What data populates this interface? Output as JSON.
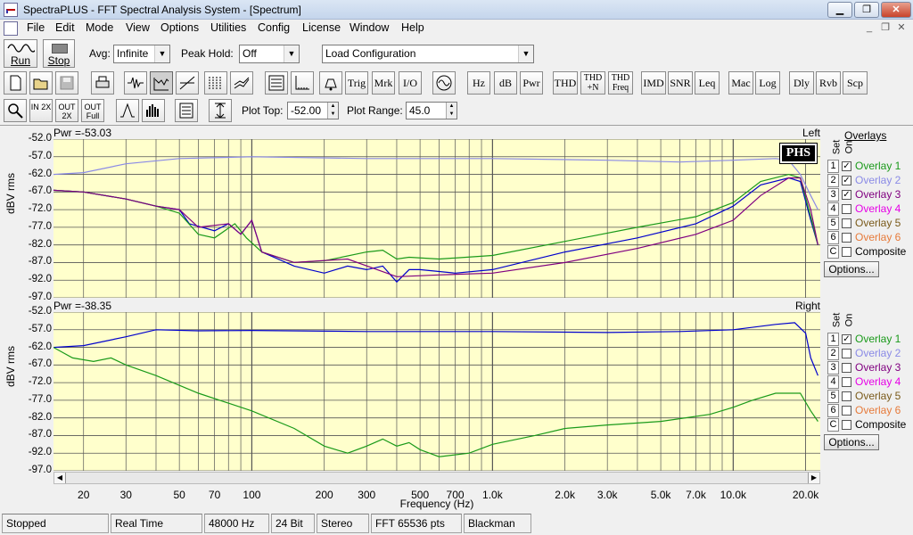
{
  "window": {
    "title": "SpectraPLUS - FFT Spectral Analysis System - [Spectrum]"
  },
  "menu": [
    "File",
    "Edit",
    "Mode",
    "View",
    "Options",
    "Utilities",
    "Config",
    "License",
    "Window",
    "Help"
  ],
  "toolbar1": {
    "run": "Run",
    "stop": "Stop",
    "avg_label": "Avg:",
    "avg_value": "Infinite",
    "peak_label": "Peak Hold:",
    "peak_value": "Off",
    "config_value": "Load Configuration"
  },
  "toolbar2": [
    "Trig",
    "Mrk",
    "I/O",
    "Hz",
    "dB",
    "Pwr",
    "THD",
    "THD +N",
    "THD Freq",
    "IMD",
    "SNR",
    "Leq",
    "Mac",
    "Log",
    "Dly",
    "Rvb",
    "Scp"
  ],
  "toolbar3": {
    "zoom_in_2x": "IN 2X",
    "zoom_out_2x": "OUT 2X",
    "zoom_out_full": "OUT Full",
    "plot_top_label": "Plot Top:",
    "plot_top_value": "-52.00",
    "plot_range_label": "Plot Range:",
    "plot_range_value": "45.0"
  },
  "plots": [
    {
      "channel": "Left",
      "pwr": "Pwr =-53.03",
      "ylabel": "dBV rms",
      "logo": "PHS"
    },
    {
      "channel": "Right",
      "pwr": "Pwr =-38.35",
      "ylabel": "dBV rms"
    }
  ],
  "y_ticks": [
    "-52.0",
    "-57.0",
    "-62.0",
    "-67.0",
    "-72.0",
    "-77.0",
    "-82.0",
    "-87.0",
    "-92.0",
    "-97.0"
  ],
  "x_ticks": [
    "20",
    "30",
    "50",
    "70",
    "100",
    "200",
    "300",
    "500",
    "700",
    "1.0k",
    "2.0k",
    "3.0k",
    "5.0k",
    "7.0k",
    "10.0k",
    "20.0k"
  ],
  "x_label": "Frequency (Hz)",
  "overlay_panel": {
    "title": "Overlays",
    "set_header": "Set",
    "on_header": "On",
    "options": "Options..."
  },
  "overlays_left": [
    {
      "num": "1",
      "name": "Overlay 1",
      "checked": true,
      "color": "#1a9a1a"
    },
    {
      "num": "2",
      "name": "Overlay 2",
      "checked": true,
      "color": "#8a8ae6"
    },
    {
      "num": "3",
      "name": "Overlay 3",
      "checked": true,
      "color": "#800080"
    },
    {
      "num": "4",
      "name": "Overlay 4",
      "checked": false,
      "color": "#e600e6"
    },
    {
      "num": "5",
      "name": "Overlay 5",
      "checked": false,
      "color": "#7a5a1a"
    },
    {
      "num": "6",
      "name": "Overlay 6",
      "checked": false,
      "color": "#e67a3a"
    },
    {
      "num": "C",
      "name": "Composite",
      "checked": false,
      "color": "#000000"
    }
  ],
  "overlays_right": [
    {
      "num": "1",
      "name": "Overlay 1",
      "checked": true,
      "color": "#1a9a1a"
    },
    {
      "num": "2",
      "name": "Overlay 2",
      "checked": false,
      "color": "#8a8ae6"
    },
    {
      "num": "3",
      "name": "Overlay 3",
      "checked": false,
      "color": "#800080"
    },
    {
      "num": "4",
      "name": "Overlay 4",
      "checked": false,
      "color": "#e600e6"
    },
    {
      "num": "5",
      "name": "Overlay 5",
      "checked": false,
      "color": "#7a5a1a"
    },
    {
      "num": "6",
      "name": "Overlay 6",
      "checked": false,
      "color": "#e67a3a"
    },
    {
      "num": "C",
      "name": "Composite",
      "checked": false,
      "color": "#000000"
    }
  ],
  "status": [
    "Stopped",
    "Real Time",
    "48000 Hz",
    "24 Bit",
    "Stereo",
    "FFT 65536 pts",
    "Blackman"
  ],
  "chart_data": [
    {
      "type": "line",
      "title": "",
      "xlabel": "Frequency (Hz)",
      "ylabel": "dBV rms",
      "x_scale": "log",
      "xlim": [
        15,
        23000
      ],
      "ylim": [
        -97,
        -52
      ],
      "series": [
        {
          "color": "#0000cc",
          "points": [
            [
              15,
              -66.5
            ],
            [
              20,
              -67
            ],
            [
              30,
              -69
            ],
            [
              40,
              -71
            ],
            [
              50,
              -72
            ],
            [
              55,
              -76
            ],
            [
              70,
              -78
            ],
            [
              80,
              -76
            ],
            [
              90,
              -79
            ],
            [
              100,
              -75
            ],
            [
              110,
              -84
            ],
            [
              150,
              -88
            ],
            [
              200,
              -90
            ],
            [
              250,
              -88
            ],
            [
              300,
              -89
            ],
            [
              350,
              -88
            ],
            [
              400,
              -92.5
            ],
            [
              450,
              -89
            ],
            [
              500,
              -89
            ],
            [
              700,
              -90
            ],
            [
              1000,
              -89
            ],
            [
              2000,
              -84
            ],
            [
              4000,
              -80
            ],
            [
              7000,
              -76
            ],
            [
              10000,
              -71
            ],
            [
              13000,
              -65
            ],
            [
              17000,
              -63
            ],
            [
              19000,
              -64
            ],
            [
              21000,
              -75
            ],
            [
              22500,
              -82
            ]
          ]
        },
        {
          "color": "#1a9a1a",
          "points": [
            [
              15,
              -66.5
            ],
            [
              20,
              -67
            ],
            [
              30,
              -69
            ],
            [
              40,
              -71
            ],
            [
              50,
              -73
            ],
            [
              60,
              -79
            ],
            [
              70,
              -80
            ],
            [
              85,
              -76
            ],
            [
              95,
              -80
            ],
            [
              110,
              -84
            ],
            [
              150,
              -87
            ],
            [
              200,
              -86.5
            ],
            [
              300,
              -84
            ],
            [
              350,
              -83.5
            ],
            [
              400,
              -86
            ],
            [
              450,
              -85.5
            ],
            [
              600,
              -86
            ],
            [
              1000,
              -85
            ],
            [
              2000,
              -81
            ],
            [
              4000,
              -77
            ],
            [
              7000,
              -74
            ],
            [
              10000,
              -70
            ],
            [
              13000,
              -64
            ],
            [
              17000,
              -62
            ],
            [
              19000,
              -63
            ],
            [
              21000,
              -74
            ],
            [
              22500,
              -82
            ]
          ]
        },
        {
          "color": "#800080",
          "points": [
            [
              15,
              -66.5
            ],
            [
              20,
              -67
            ],
            [
              30,
              -69
            ],
            [
              40,
              -71
            ],
            [
              50,
              -72
            ],
            [
              60,
              -77
            ],
            [
              80,
              -76
            ],
            [
              90,
              -79
            ],
            [
              100,
              -75
            ],
            [
              110,
              -84
            ],
            [
              150,
              -87
            ],
            [
              250,
              -86
            ],
            [
              400,
              -91
            ],
            [
              600,
              -90.5
            ],
            [
              1000,
              -90
            ],
            [
              2000,
              -87
            ],
            [
              4000,
              -83
            ],
            [
              7000,
              -79
            ],
            [
              10000,
              -75
            ],
            [
              13000,
              -68
            ],
            [
              17000,
              -63
            ],
            [
              19000,
              -63
            ],
            [
              21000,
              -72
            ],
            [
              22500,
              -82
            ]
          ]
        },
        {
          "color": "#8a8ae6",
          "points": [
            [
              15,
              -62
            ],
            [
              20,
              -61.5
            ],
            [
              30,
              -59
            ],
            [
              50,
              -57.5
            ],
            [
              100,
              -57
            ],
            [
              300,
              -57.5
            ],
            [
              1000,
              -57.5
            ],
            [
              3000,
              -58
            ],
            [
              6000,
              -58.5
            ],
            [
              10000,
              -58
            ],
            [
              15000,
              -57.5
            ],
            [
              17000,
              -58
            ],
            [
              19000,
              -62
            ],
            [
              21000,
              -68
            ],
            [
              22500,
              -72
            ]
          ]
        }
      ]
    },
    {
      "type": "line",
      "title": "",
      "xlabel": "Frequency (Hz)",
      "ylabel": "dBV rms",
      "x_scale": "log",
      "xlim": [
        15,
        23000
      ],
      "ylim": [
        -97,
        -52
      ],
      "series": [
        {
          "color": "#0000cc",
          "points": [
            [
              15,
              -62
            ],
            [
              20,
              -61.5
            ],
            [
              30,
              -59
            ],
            [
              40,
              -57
            ],
            [
              60,
              -57.3
            ],
            [
              100,
              -57.2
            ],
            [
              300,
              -57.5
            ],
            [
              1000,
              -57.5
            ],
            [
              3000,
              -57.8
            ],
            [
              6000,
              -57.5
            ],
            [
              10000,
              -57
            ],
            [
              15000,
              -55.5
            ],
            [
              18000,
              -55
            ],
            [
              20000,
              -58
            ],
            [
              21000,
              -65
            ],
            [
              22500,
              -70
            ]
          ]
        },
        {
          "color": "#1a9a1a",
          "points": [
            [
              15,
              -62
            ],
            [
              18,
              -65
            ],
            [
              22,
              -66
            ],
            [
              26,
              -65
            ],
            [
              30,
              -67
            ],
            [
              40,
              -70
            ],
            [
              60,
              -75
            ],
            [
              100,
              -80
            ],
            [
              150,
              -85
            ],
            [
              200,
              -90
            ],
            [
              250,
              -92
            ],
            [
              300,
              -90
            ],
            [
              350,
              -88
            ],
            [
              400,
              -90
            ],
            [
              450,
              -89
            ],
            [
              500,
              -91
            ],
            [
              600,
              -93
            ],
            [
              800,
              -92
            ],
            [
              1000,
              -89.5
            ],
            [
              1500,
              -87
            ],
            [
              2000,
              -85
            ],
            [
              3000,
              -84
            ],
            [
              5000,
              -83
            ],
            [
              8000,
              -81
            ],
            [
              10000,
              -79
            ],
            [
              12000,
              -77
            ],
            [
              15000,
              -75
            ],
            [
              19000,
              -75
            ],
            [
              21000,
              -80
            ],
            [
              22500,
              -83
            ]
          ]
        }
      ]
    }
  ]
}
